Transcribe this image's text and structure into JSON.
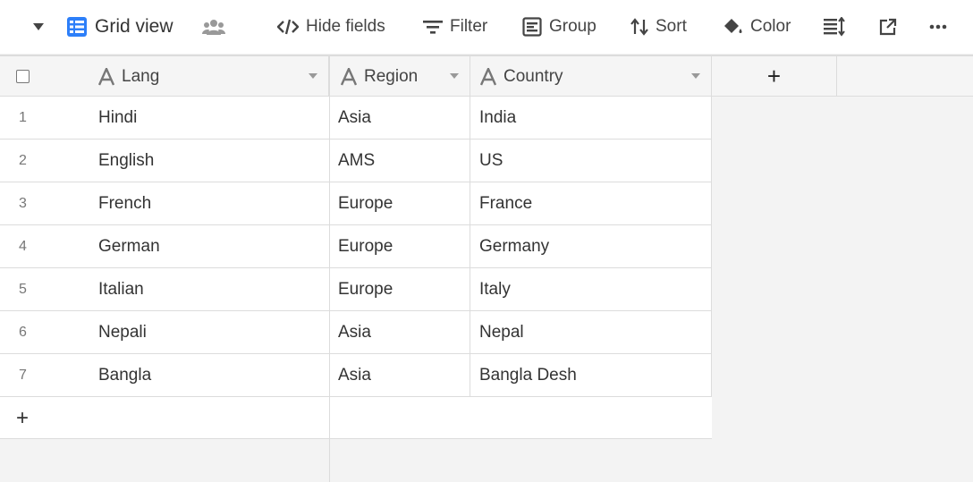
{
  "toolbar": {
    "view_name": "Grid view",
    "hide_fields": "Hide fields",
    "filter": "Filter",
    "group": "Group",
    "sort": "Sort",
    "color": "Color",
    "icons": [
      "caret-down-icon",
      "grid-icon",
      "people-icon",
      "hide-fields-icon",
      "filter-icon",
      "group-icon",
      "sort-icon",
      "color-bucket-icon",
      "row-height-icon",
      "share-icon",
      "more-icon"
    ]
  },
  "grid": {
    "columns": [
      {
        "name": "Lang",
        "type_icon": "text-type-icon"
      },
      {
        "name": "Region",
        "type_icon": "text-type-icon"
      },
      {
        "name": "Country",
        "type_icon": "text-type-icon"
      }
    ],
    "add_column": "+",
    "add_row": "+",
    "rows": [
      {
        "num": "1",
        "lang": "Hindi",
        "region": "Asia",
        "country": "India"
      },
      {
        "num": "2",
        "lang": "English",
        "region": "AMS",
        "country": "US"
      },
      {
        "num": "3",
        "lang": "French",
        "region": "Europe",
        "country": "France"
      },
      {
        "num": "4",
        "lang": "German",
        "region": "Europe",
        "country": "Germany"
      },
      {
        "num": "5",
        "lang": "Italian",
        "region": "Europe",
        "country": "Italy"
      },
      {
        "num": "6",
        "lang": "Nepali",
        "region": "Asia",
        "country": "Nepal"
      },
      {
        "num": "7",
        "lang": "Bangla",
        "region": "Asia",
        "country": "Bangla Desh"
      }
    ]
  },
  "colors": {
    "accent_blue": "#2d7ff9",
    "border": "#dcdcdc",
    "header_bg": "#f5f5f5"
  }
}
